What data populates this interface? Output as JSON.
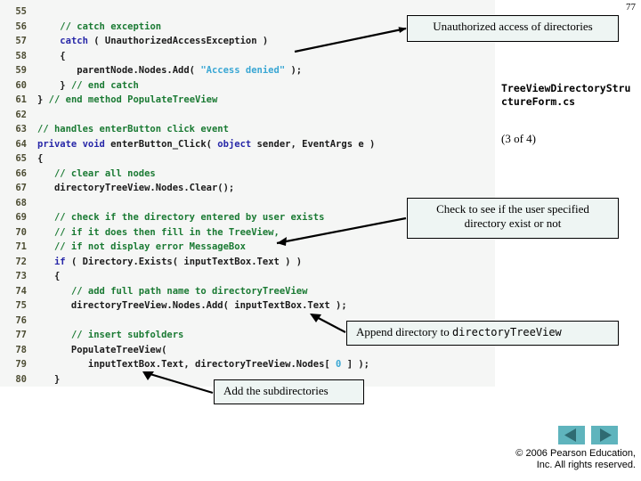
{
  "slide": {
    "number": "77",
    "file_title": "TreeViewDirectoryStructureForm.cs",
    "part_label": "(3 of 4)",
    "copyright_line1": "© 2006 Pearson Education,",
    "copyright_line2": "Inc.  All rights reserved."
  },
  "colors": {
    "code_background": "#f5f6f5",
    "comment": "#1a7a33",
    "keyword": "#2727a8",
    "string": "#3aa7d4",
    "plain": "#1a1a1a",
    "lineno": "#4d4d33",
    "callout_fill": "#eef5f3",
    "callout_border": "#000000",
    "nav_button": "#5fb4bd"
  },
  "code": {
    "first_line": 55,
    "lines": [
      {
        "n": "55",
        "tokens": []
      },
      {
        "n": "56",
        "tokens": [
          {
            "t": "    ",
            "c": "pl"
          },
          {
            "t": "// catch exception",
            "c": "cm"
          }
        ]
      },
      {
        "n": "57",
        "tokens": [
          {
            "t": "    ",
            "c": "pl"
          },
          {
            "t": "catch",
            "c": "kw"
          },
          {
            "t": " ( UnauthorizedAccessException )",
            "c": "pl"
          }
        ]
      },
      {
        "n": "58",
        "tokens": [
          {
            "t": "    {",
            "c": "pl"
          }
        ]
      },
      {
        "n": "59",
        "tokens": [
          {
            "t": "       parentNode.Nodes.Add( ",
            "c": "pl"
          },
          {
            "t": "\"Access denied\"",
            "c": "str"
          },
          {
            "t": " );",
            "c": "pl"
          }
        ]
      },
      {
        "n": "60",
        "tokens": [
          {
            "t": "    } ",
            "c": "pl"
          },
          {
            "t": "// end catch",
            "c": "cm"
          }
        ]
      },
      {
        "n": "61",
        "tokens": [
          {
            "t": "} ",
            "c": "pl"
          },
          {
            "t": "// end method PopulateTreeView",
            "c": "cm"
          }
        ]
      },
      {
        "n": "62",
        "tokens": []
      },
      {
        "n": "63",
        "tokens": [
          {
            "t": "// handles enterButton click event",
            "c": "cm"
          }
        ]
      },
      {
        "n": "64",
        "tokens": [
          {
            "t": "private void",
            "c": "kw"
          },
          {
            "t": " enterButton_Click( ",
            "c": "pl"
          },
          {
            "t": "object",
            "c": "kw"
          },
          {
            "t": " sender, EventArgs e )",
            "c": "pl"
          }
        ]
      },
      {
        "n": "65",
        "tokens": [
          {
            "t": "{",
            "c": "pl"
          }
        ]
      },
      {
        "n": "66",
        "tokens": [
          {
            "t": "   ",
            "c": "pl"
          },
          {
            "t": "// clear all nodes",
            "c": "cm"
          }
        ]
      },
      {
        "n": "67",
        "tokens": [
          {
            "t": "   directoryTreeView.Nodes.Clear();",
            "c": "pl"
          }
        ]
      },
      {
        "n": "68",
        "tokens": []
      },
      {
        "n": "69",
        "tokens": [
          {
            "t": "   ",
            "c": "pl"
          },
          {
            "t": "// check if the directory entered by user exists",
            "c": "cm"
          }
        ]
      },
      {
        "n": "70",
        "tokens": [
          {
            "t": "   ",
            "c": "pl"
          },
          {
            "t": "// if it does then fill in the TreeView,",
            "c": "cm"
          }
        ]
      },
      {
        "n": "71",
        "tokens": [
          {
            "t": "   ",
            "c": "pl"
          },
          {
            "t": "// if not display error MessageBox",
            "c": "cm"
          }
        ]
      },
      {
        "n": "72",
        "tokens": [
          {
            "t": "   ",
            "c": "pl"
          },
          {
            "t": "if",
            "c": "kw"
          },
          {
            "t": " ( Directory.Exists( inputTextBox.Text ) )",
            "c": "pl"
          }
        ]
      },
      {
        "n": "73",
        "tokens": [
          {
            "t": "   {",
            "c": "pl"
          }
        ]
      },
      {
        "n": "74",
        "tokens": [
          {
            "t": "      ",
            "c": "pl"
          },
          {
            "t": "// add full path name to directoryTreeView",
            "c": "cm"
          }
        ]
      },
      {
        "n": "75",
        "tokens": [
          {
            "t": "      directoryTreeView.Nodes.Add( inputTextBox.Text );",
            "c": "pl"
          }
        ]
      },
      {
        "n": "76",
        "tokens": []
      },
      {
        "n": "77",
        "tokens": [
          {
            "t": "      ",
            "c": "pl"
          },
          {
            "t": "// insert subfolders",
            "c": "cm"
          }
        ]
      },
      {
        "n": "78",
        "tokens": [
          {
            "t": "      PopulateTreeView(",
            "c": "pl"
          }
        ]
      },
      {
        "n": "79",
        "tokens": [
          {
            "t": "         inputTextBox.Text, directoryTreeView.Nodes[ ",
            "c": "pl"
          },
          {
            "t": "0",
            "c": "num"
          },
          {
            "t": " ] );",
            "c": "pl"
          }
        ]
      },
      {
        "n": "80",
        "tokens": [
          {
            "t": "   }",
            "c": "pl"
          }
        ]
      }
    ]
  },
  "callouts": {
    "unauthorized": {
      "text": "Unauthorized access of directories"
    },
    "check_directory": {
      "line1": "Check to see if the user specified",
      "line2": "directory exist or not"
    },
    "append_directory": {
      "prefix": "Append directory to ",
      "mono": "directoryTreeView"
    },
    "add_subdirectories": {
      "text": "Add the subdirectories"
    }
  },
  "nav": {
    "prev_label": "previous-slide",
    "next_label": "next-slide"
  }
}
